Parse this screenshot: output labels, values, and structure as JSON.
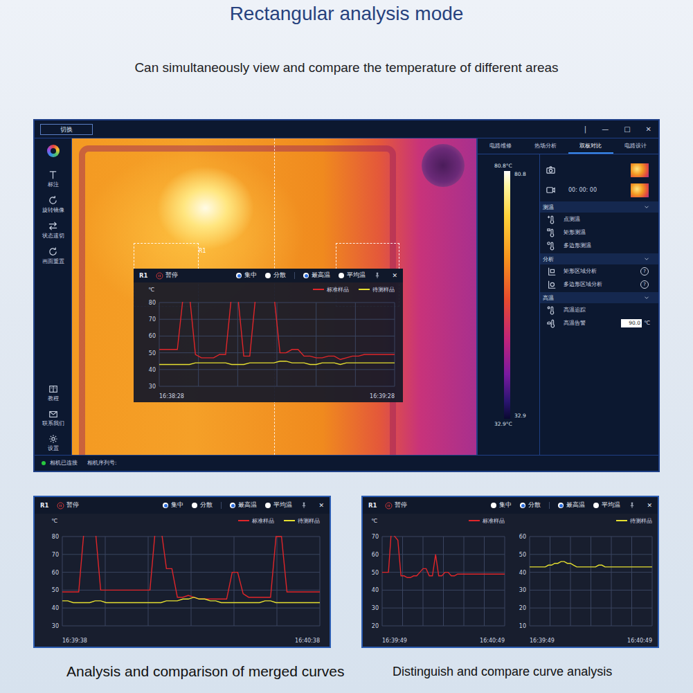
{
  "page": {
    "title": "Rectangular analysis mode",
    "subtitle": "Can simultaneously view and compare the temperature of different areas"
  },
  "window": {
    "switch_button": "切换",
    "controls": [
      "|",
      "—",
      "□",
      "✕"
    ]
  },
  "sidebar": {
    "top_items": [
      "标注",
      "旋转镜像",
      "状态速切",
      "画面重置"
    ],
    "bottom_items": [
      "教程",
      "联系我们",
      "设置"
    ]
  },
  "thermal_view": {
    "roi_label": "R1",
    "popup": {
      "title": "R1",
      "pause": "暂停",
      "modes": [
        {
          "label": "集中",
          "selected": true
        },
        {
          "label": "分散",
          "selected": false
        }
      ],
      "metrics": [
        {
          "label": "最高温",
          "selected": true
        },
        {
          "label": "平均温",
          "selected": false
        }
      ],
      "close": "✕",
      "unit": "℃",
      "charts": [
        {
          "y_ticks": [
            "80",
            "70",
            "60",
            "50",
            "40",
            "30"
          ],
          "x_labels": [
            "16:38:28",
            "16:39:28"
          ],
          "series": [
            {
              "label": "标准样品",
              "color": "#e0262a",
              "values": [
                52,
                52,
                52,
                52,
                85,
                85,
                49,
                47,
                47,
                47,
                49,
                49,
                85,
                85,
                48,
                48,
                85,
                85,
                85,
                85,
                50,
                50,
                52,
                52,
                48,
                48,
                47,
                47,
                48,
                48,
                46,
                47,
                48,
                48,
                49,
                49,
                49,
                49,
                49,
                49
              ]
            },
            {
              "label": "待测样品",
              "color": "#e6e030",
              "values": [
                43,
                43,
                43,
                43,
                43,
                43,
                44,
                44,
                44,
                44,
                44,
                44,
                43,
                43,
                43,
                44,
                44,
                44,
                44,
                44,
                45,
                45,
                44,
                44,
                44,
                43,
                43,
                44,
                44,
                44,
                43,
                44,
                44,
                44,
                44,
                44,
                44,
                44,
                44,
                44
              ]
            }
          ]
        }
      ]
    }
  },
  "right_panel": {
    "tabs": [
      {
        "label": "电路维修",
        "selected": false
      },
      {
        "label": "热场分析",
        "selected": false
      },
      {
        "label": "双板对比",
        "selected": true
      },
      {
        "label": "电路设计",
        "selected": false
      }
    ],
    "scale": {
      "max_label": "80.8°C",
      "max": "80.8",
      "min": "32.9",
      "min_label": "32.9°C"
    },
    "capture": {
      "timer": "00: 00: 00"
    },
    "sections": [
      {
        "title": "测温",
        "expanded": true,
        "items": [
          {
            "label": "点测温",
            "kind": "plain"
          },
          {
            "label": "矩形测温",
            "kind": "plain"
          },
          {
            "label": "多边形测温",
            "kind": "plain"
          }
        ]
      },
      {
        "title": "分析",
        "expanded": true,
        "items": [
          {
            "label": "矩形区域分析",
            "kind": "help",
            "help": "?"
          },
          {
            "label": "多边形区域分析",
            "kind": "help",
            "help": "?"
          }
        ]
      },
      {
        "title": "高温",
        "expanded": true,
        "items": [
          {
            "label": "高温追踪",
            "kind": "plain"
          },
          {
            "label": "高温告警",
            "kind": "input",
            "value": "90.0",
            "unit": "℃"
          }
        ]
      }
    ]
  },
  "status_bar": {
    "connected": true,
    "text": "相机已连接",
    "serial_label": "相机序列号:"
  },
  "bottom_panels": [
    {
      "title": "R1",
      "pause": "暂停",
      "modes": [
        {
          "label": "集中",
          "selected": true
        },
        {
          "label": "分散",
          "selected": false
        }
      ],
      "metrics": [
        {
          "label": "最高温",
          "selected": true
        },
        {
          "label": "平均温",
          "selected": false
        }
      ],
      "close": "✕",
      "unit": "℃",
      "charts": [
        {
          "y_ticks": [
            "80",
            "70",
            "60",
            "50",
            "40",
            "30"
          ],
          "x_labels": [
            "16:39:38",
            "16:40:38"
          ],
          "series": [
            {
              "label": "标准样品",
              "color": "#e0262a",
              "values": [
                49,
                49,
                49,
                49,
                85,
                85,
                85,
                50,
                50,
                50,
                50,
                50,
                50,
                50,
                50,
                50,
                50,
                85,
                85,
                62,
                62,
                46,
                46,
                47,
                46,
                45,
                45,
                45,
                45,
                45,
                45,
                60,
                60,
                48,
                46,
                46,
                46,
                46,
                46,
                80,
                80,
                49,
                49,
                49,
                49,
                49,
                49,
                49
              ]
            },
            {
              "label": "待测样品",
              "color": "#e6e030",
              "values": [
                44,
                44,
                43,
                43,
                43,
                43,
                44,
                44,
                43,
                43,
                43,
                43,
                43,
                43,
                43,
                43,
                43,
                43,
                43,
                44,
                44,
                44,
                45,
                45,
                46,
                45,
                45,
                44,
                44,
                43,
                43,
                43,
                43,
                43,
                43,
                43,
                43,
                44,
                44,
                43,
                43,
                43,
                43,
                43,
                43,
                43,
                43,
                43
              ]
            }
          ]
        }
      ]
    },
    {
      "title": "R1",
      "pause": "暂停",
      "modes": [
        {
          "label": "集中",
          "selected": false
        },
        {
          "label": "分散",
          "selected": true
        }
      ],
      "metrics": [
        {
          "label": "最高温",
          "selected": true
        },
        {
          "label": "平均温",
          "selected": false
        }
      ],
      "close": "✕",
      "unit": "℃",
      "charts": [
        {
          "y_ticks": [
            "70",
            "60",
            "50",
            "40",
            "30",
            "20"
          ],
          "x_labels": [
            "16:39:49",
            "16:40:49"
          ],
          "series": [
            {
              "label": "标准样品",
              "color": "#e0262a",
              "values": [
                50,
                50,
                50,
                75,
                70,
                68,
                48,
                48,
                47,
                47,
                48,
                48,
                50,
                52,
                52,
                48,
                48,
                60,
                48,
                48,
                50,
                50,
                48,
                48,
                49,
                49,
                49,
                49,
                49,
                49,
                49,
                49,
                49,
                49,
                49,
                49,
                49,
                49,
                49,
                49
              ]
            }
          ]
        },
        {
          "y_ticks": [
            "60",
            "50",
            "40",
            "30",
            "20",
            "10"
          ],
          "x_labels": [
            "16:39:49",
            "16:40:49"
          ],
          "series": [
            {
              "label": "待测样品",
              "color": "#e6e030",
              "values": [
                43,
                43,
                43,
                43,
                43,
                43,
                44,
                44,
                45,
                45,
                46,
                46,
                45,
                45,
                44,
                43,
                43,
                43,
                43,
                43,
                43,
                43,
                44,
                44,
                43,
                43,
                43,
                43,
                43,
                43,
                43,
                43,
                43,
                43,
                43,
                43,
                43,
                43,
                43,
                43
              ]
            }
          ]
        }
      ]
    }
  ],
  "captions": [
    "Analysis and comparison of merged curves",
    "Distinguish and compare curve analysis"
  ]
}
